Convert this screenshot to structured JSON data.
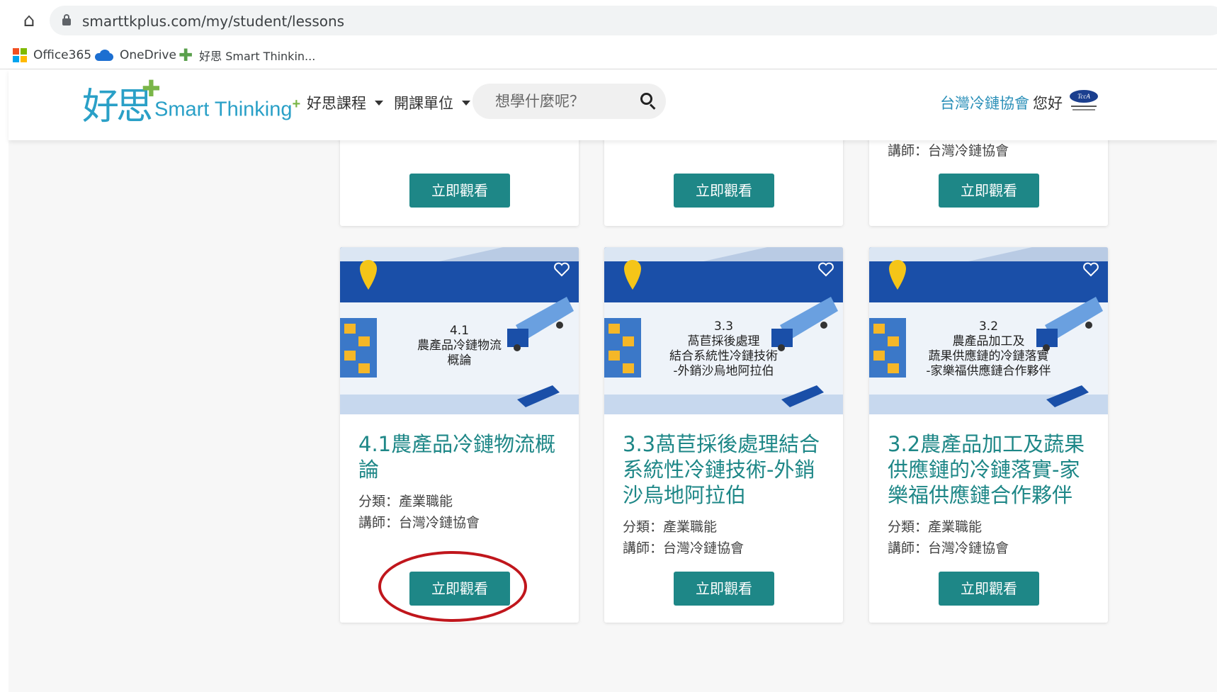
{
  "browser": {
    "url": "smarttkplus.com/my/student/lessons",
    "bookmarks": [
      {
        "label": "Office365"
      },
      {
        "label": "OneDrive"
      },
      {
        "label": "好思 Smart Thinkin..."
      }
    ]
  },
  "header": {
    "logo_cn": "好思",
    "logo_en": "Smart Thinking",
    "nav": [
      {
        "label": "好思課程"
      },
      {
        "label": "開課單位"
      }
    ],
    "search_placeholder": "想學什麼呢？",
    "org_link": "台灣冷鏈協會",
    "greeting": "您好"
  },
  "top_row": {
    "watch_label": "立即觀看",
    "partial_instructor": "講師：台灣冷鏈協會"
  },
  "lessons": [
    {
      "thumb_lines": "4.1\n農產品冷鏈物流\n概論",
      "title": "4.1農產品冷鏈物流概論",
      "category": "分類：產業職能",
      "instructor": "講師：台灣冷鏈協會",
      "watch_label": "立即觀看"
    },
    {
      "thumb_lines": "3.3\n萵苣採後處理\n結合系統性冷鏈技術\n-外銷沙烏地阿拉伯",
      "title": "3.3萵苣採後處理結合系統性冷鏈技術-外銷沙烏地阿拉伯",
      "category": "分類：產業職能",
      "instructor": "講師：台灣冷鏈協會",
      "watch_label": "立即觀看"
    },
    {
      "thumb_lines": "3.2\n農產品加工及\n蔬果供應鏈的冷鏈落實\n-家樂福供應鏈合作夥伴",
      "title": "3.2農產品加工及蔬果供應鏈的冷鏈落實-家樂福供應鏈合作夥伴",
      "category": "分類：產業職能",
      "instructor": "講師：台灣冷鏈協會",
      "watch_label": "立即觀看"
    }
  ],
  "colors": {
    "accent": "#1e8787",
    "highlight_circle": "#c0161c",
    "banner_blue": "#1a4fa8"
  }
}
